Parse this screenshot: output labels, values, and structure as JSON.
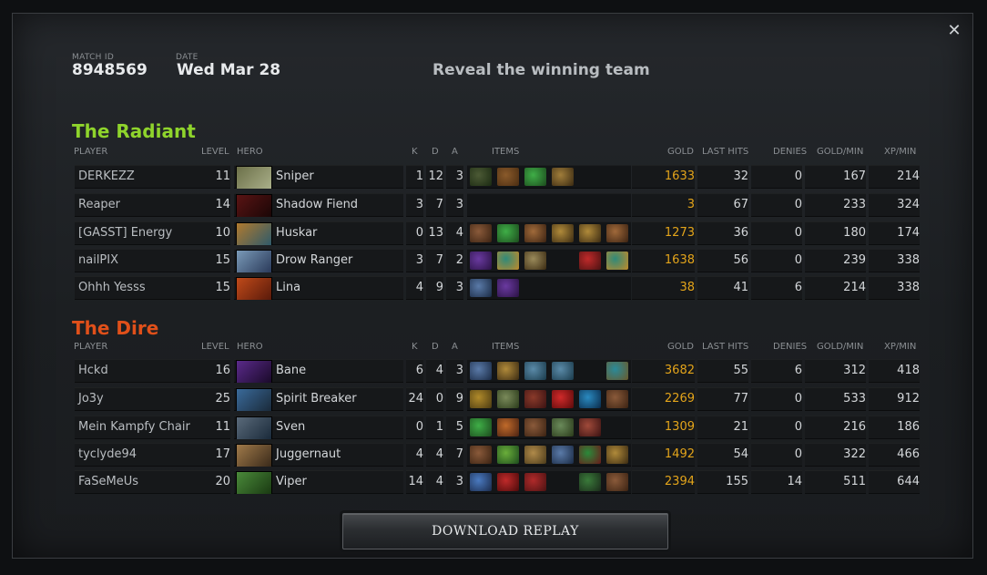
{
  "match": {
    "id_label": "MATCH ID",
    "id_value": "8948569",
    "date_label": "DATE",
    "date_value": "Wed Mar 28",
    "reveal_label": "Reveal the winning team"
  },
  "headers": {
    "player": "PLAYER",
    "level": "LEVEL",
    "hero": "HERO",
    "k": "K",
    "d": "D",
    "a": "A",
    "items": "ITEMS",
    "gold": "GOLD",
    "last_hits": "LAST HITS",
    "denies": "DENIES",
    "gold_min": "GOLD/MIN",
    "xp_min": "XP/MIN"
  },
  "radiant": {
    "title": "The Radiant",
    "color": "#8fd42c",
    "players": [
      {
        "player": "DERKEZZ",
        "level": "11",
        "hero": "Sniper",
        "hero_colors": [
          "#6b6f48",
          "#aab08a"
        ],
        "k": "1",
        "d": "12",
        "a": "3",
        "items": [
          {
            "slot": 0,
            "colors": [
              "#4c5a35",
              "#1b2a12"
            ]
          },
          {
            "slot": 1,
            "colors": [
              "#8a5a2a",
              "#4a2d12"
            ]
          },
          {
            "slot": 2,
            "colors": [
              "#3fae47",
              "#1c4a1d"
            ]
          },
          {
            "slot": 3,
            "colors": [
              "#a07d3a",
              "#3a2a12"
            ]
          }
        ],
        "gold": "1633",
        "last_hits": "32",
        "denies": "0",
        "gold_min": "167",
        "xp_min": "214"
      },
      {
        "player": "Reaper",
        "level": "14",
        "hero": "Shadow Fiend",
        "hero_colors": [
          "#5a1414",
          "#1a0606"
        ],
        "k": "3",
        "d": "7",
        "a": "3",
        "items": [],
        "gold": "3",
        "last_hits": "67",
        "denies": "0",
        "gold_min": "233",
        "xp_min": "324"
      },
      {
        "player": "[GASST] Energy",
        "level": "10",
        "hero": "Huskar",
        "hero_colors": [
          "#b07a2e",
          "#2f5a6a"
        ],
        "k": "0",
        "d": "13",
        "a": "4",
        "items": [
          {
            "slot": 0,
            "colors": [
              "#8a5a3a",
              "#3a2212"
            ]
          },
          {
            "slot": 1,
            "colors": [
              "#3fae47",
              "#1c4a1d"
            ]
          },
          {
            "slot": 2,
            "colors": [
              "#a06a3a",
              "#3a2212"
            ]
          },
          {
            "slot": 3,
            "colors": [
              "#b08a3a",
              "#3a2a12"
            ]
          },
          {
            "slot": 4,
            "colors": [
              "#b08a3a",
              "#3a2a12"
            ]
          },
          {
            "slot": 5,
            "colors": [
              "#a0693a",
              "#3a2212"
            ]
          }
        ],
        "gold": "1273",
        "last_hits": "36",
        "denies": "0",
        "gold_min": "180",
        "xp_min": "174"
      },
      {
        "player": "nailPIX",
        "level": "15",
        "hero": "Drow Ranger",
        "hero_colors": [
          "#7a9ab8",
          "#2a3a5a"
        ],
        "k": "3",
        "d": "7",
        "a": "2",
        "items": [
          {
            "slot": 0,
            "colors": [
              "#6a3aa0",
              "#2a1244"
            ]
          },
          {
            "slot": 1,
            "colors": [
              "#2f8a7a",
              "#c08a2a"
            ]
          },
          {
            "slot": 2,
            "colors": [
              "#9a8a5a",
              "#3a2a12"
            ]
          },
          {
            "slot": 4,
            "colors": [
              "#c02a2a",
              "#4a1212"
            ]
          },
          {
            "slot": 5,
            "colors": [
              "#2f8a7a",
              "#c08a2a"
            ]
          }
        ],
        "gold": "1638",
        "last_hits": "56",
        "denies": "0",
        "gold_min": "239",
        "xp_min": "338"
      },
      {
        "player": "Ohhh Yesss",
        "level": "15",
        "hero": "Lina",
        "hero_colors": [
          "#c04a1a",
          "#5a1a0a"
        ],
        "k": "4",
        "d": "9",
        "a": "3",
        "items": [
          {
            "slot": 0,
            "colors": [
              "#5a7aa8",
              "#1a2a44"
            ]
          },
          {
            "slot": 1,
            "colors": [
              "#6a3aa0",
              "#2a1244"
            ]
          }
        ],
        "gold": "38",
        "last_hits": "41",
        "denies": "6",
        "gold_min": "214",
        "xp_min": "338"
      }
    ]
  },
  "dire": {
    "title": "The Dire",
    "color": "#e0501a",
    "players": [
      {
        "player": "Hckd",
        "level": "16",
        "hero": "Bane",
        "hero_colors": [
          "#5a2a8a",
          "#1a0a2a"
        ],
        "k": "6",
        "d": "4",
        "a": "3",
        "items": [
          {
            "slot": 0,
            "colors": [
              "#5a7aa8",
              "#1a2a44"
            ]
          },
          {
            "slot": 1,
            "colors": [
              "#b08a3a",
              "#3a2a12"
            ]
          },
          {
            "slot": 2,
            "colors": [
              "#5a8aa8",
              "#1a3a4a"
            ]
          },
          {
            "slot": 3,
            "colors": [
              "#5a8aa8",
              "#1a3a4a"
            ]
          },
          {
            "slot": 5,
            "colors": [
              "#2a8a9a",
              "#6a5a2a"
            ]
          }
        ],
        "gold": "3682",
        "last_hits": "55",
        "denies": "6",
        "gold_min": "312",
        "xp_min": "418"
      },
      {
        "player": "Jo3y",
        "level": "25",
        "hero": "Spirit Breaker",
        "hero_colors": [
          "#3a6a9a",
          "#1a2a3a"
        ],
        "k": "24",
        "d": "0",
        "a": "9",
        "items": [
          {
            "slot": 0,
            "colors": [
              "#b08a2a",
              "#4a3a12"
            ]
          },
          {
            "slot": 1,
            "colors": [
              "#7a8a5a",
              "#2a3a1a"
            ]
          },
          {
            "slot": 2,
            "colors": [
              "#8a3a2a",
              "#3a1212"
            ]
          },
          {
            "slot": 3,
            "colors": [
              "#d02a2a",
              "#5a0a0a"
            ]
          },
          {
            "slot": 4,
            "colors": [
              "#2a8ac0",
              "#0a2a4a"
            ]
          },
          {
            "slot": 5,
            "colors": [
              "#8a5a3a",
              "#3a2212"
            ]
          }
        ],
        "gold": "2269",
        "last_hits": "77",
        "denies": "0",
        "gold_min": "533",
        "xp_min": "912"
      },
      {
        "player": "Mein Kampfy Chair",
        "level": "11",
        "hero": "Sven",
        "hero_colors": [
          "#5a6a7a",
          "#1a2a3a"
        ],
        "k": "0",
        "d": "1",
        "a": "5",
        "items": [
          {
            "slot": 0,
            "colors": [
              "#3fae47",
              "#1c4a1d"
            ]
          },
          {
            "slot": 1,
            "colors": [
              "#c06a2a",
              "#4a2212"
            ]
          },
          {
            "slot": 2,
            "colors": [
              "#8a5a3a",
              "#3a2212"
            ]
          },
          {
            "slot": 3,
            "colors": [
              "#6a8a5a",
              "#2a3a1a"
            ]
          },
          {
            "slot": 4,
            "colors": [
              "#a04a3a",
              "#3a1212"
            ]
          }
        ],
        "gold": "1309",
        "last_hits": "21",
        "denies": "0",
        "gold_min": "216",
        "xp_min": "186"
      },
      {
        "player": "tyclyde94",
        "level": "17",
        "hero": "Juggernaut",
        "hero_colors": [
          "#a07a4a",
          "#3a2a1a"
        ],
        "k": "4",
        "d": "4",
        "a": "7",
        "items": [
          {
            "slot": 0,
            "colors": [
              "#8a5a3a",
              "#3a2212"
            ]
          },
          {
            "slot": 1,
            "colors": [
              "#6aae3a",
              "#1c4a1d"
            ]
          },
          {
            "slot": 2,
            "colors": [
              "#b08a4a",
              "#4a3a1a"
            ]
          },
          {
            "slot": 3,
            "colors": [
              "#5a7aa8",
              "#1a2a44"
            ]
          },
          {
            "slot": 4,
            "colors": [
              "#2a8a3a",
              "#6a1a1a"
            ]
          },
          {
            "slot": 5,
            "colors": [
              "#b08a3a",
              "#3a2a12"
            ]
          }
        ],
        "gold": "1492",
        "last_hits": "54",
        "denies": "0",
        "gold_min": "322",
        "xp_min": "466"
      },
      {
        "player": "FaSeMeUs",
        "level": "20",
        "hero": "Viper",
        "hero_colors": [
          "#4a8a3a",
          "#1a3a12"
        ],
        "k": "14",
        "d": "4",
        "a": "3",
        "items": [
          {
            "slot": 0,
            "colors": [
              "#4a7ac0",
              "#1a2a4a"
            ]
          },
          {
            "slot": 1,
            "colors": [
              "#c02a2a",
              "#4a0a0a"
            ]
          },
          {
            "slot": 2,
            "colors": [
              "#b02a2a",
              "#4a1212"
            ]
          },
          {
            "slot": 4,
            "colors": [
              "#3a7a3a",
              "#1a2a1a"
            ]
          },
          {
            "slot": 5,
            "colors": [
              "#8a5a3a",
              "#3a2212"
            ]
          }
        ],
        "gold": "2394",
        "last_hits": "155",
        "denies": "14",
        "gold_min": "511",
        "xp_min": "644"
      }
    ]
  },
  "download_label": "DOWNLOAD REPLAY"
}
